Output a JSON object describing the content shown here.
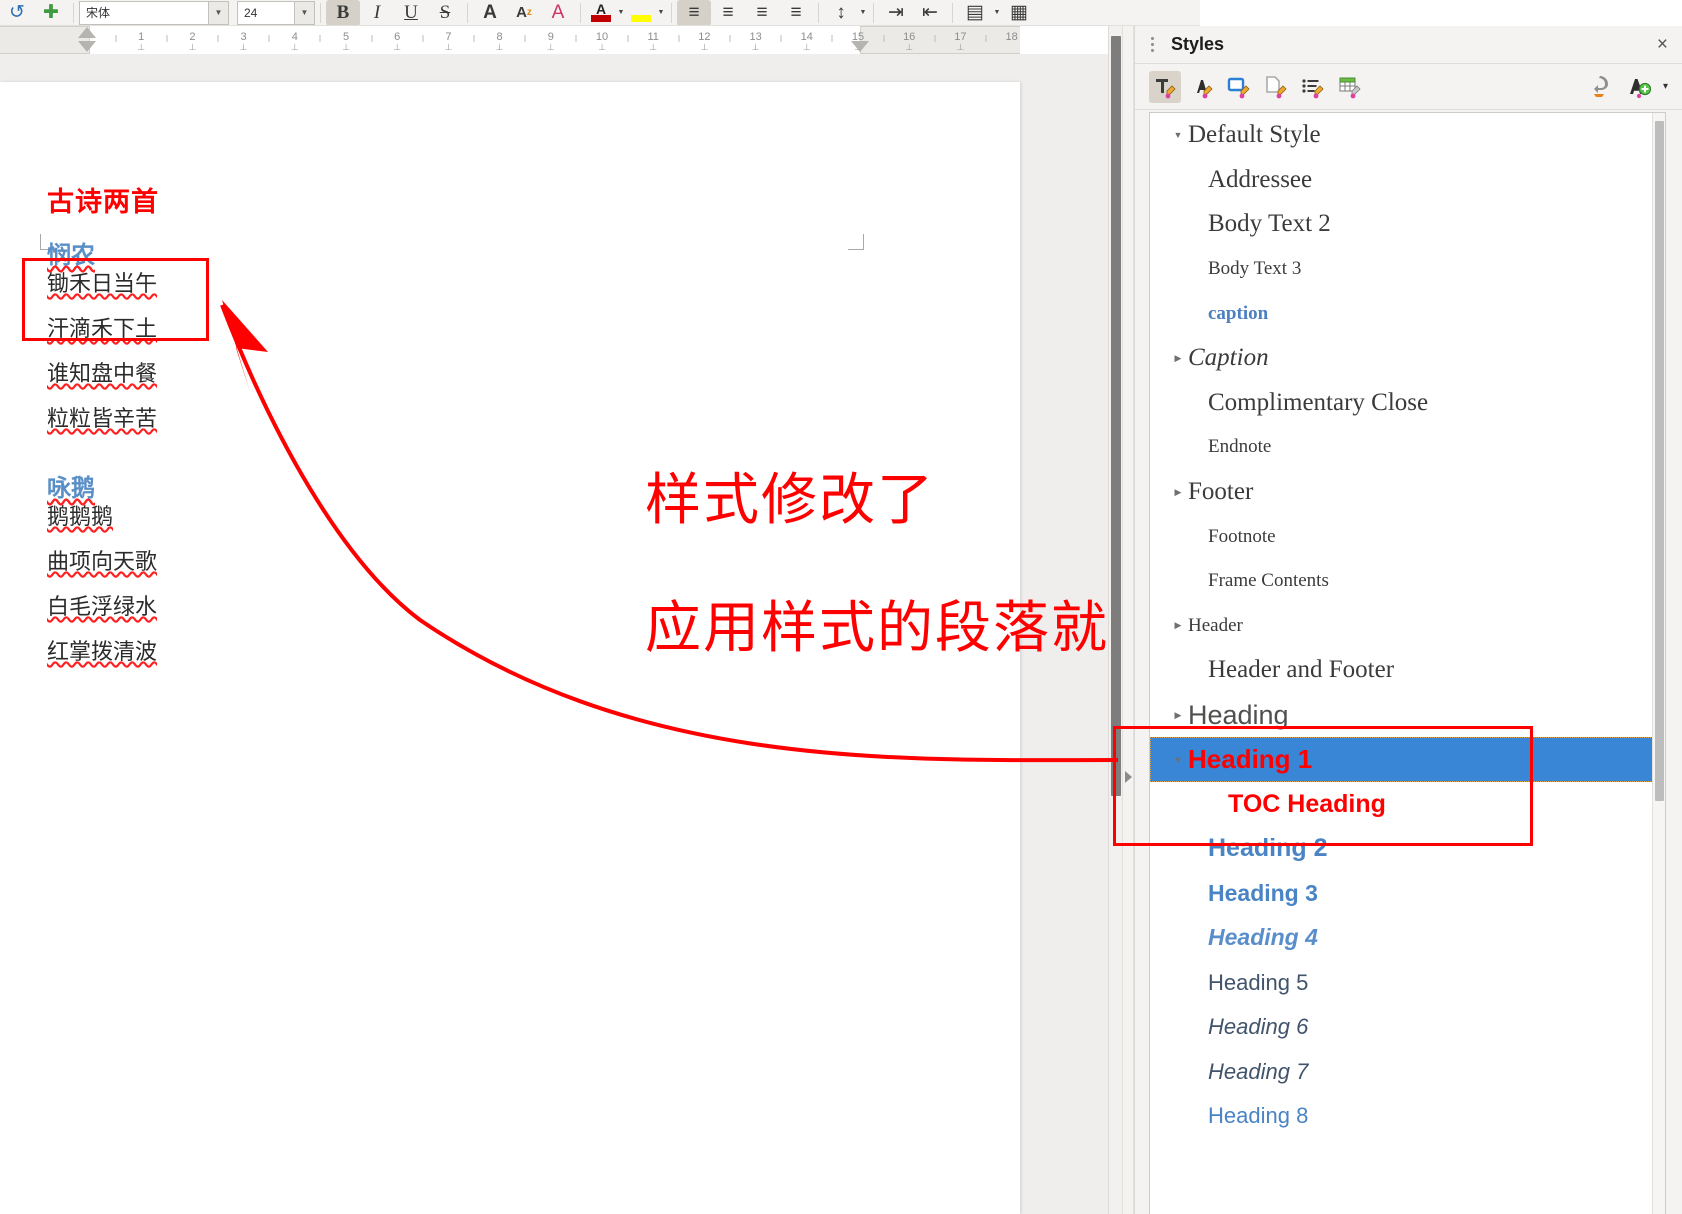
{
  "app": {
    "name": "LibreOffice Writer"
  },
  "toolbar": {
    "font_name_value": "宋体",
    "font_size_value": "24",
    "buttons": [
      {
        "name": "undo-icon",
        "glyph": "↺"
      },
      {
        "name": "insert-special-icon",
        "glyph": "✚"
      },
      {
        "name": "bold-button",
        "glyph": "B",
        "pressed": true
      },
      {
        "name": "italic-button",
        "glyph": "I"
      },
      {
        "name": "underline-button",
        "glyph": "U"
      },
      {
        "name": "strikethrough-button",
        "glyph": "S"
      },
      {
        "name": "increase-font-button",
        "glyph": "A"
      },
      {
        "name": "decrease-font-button",
        "glyph": "A"
      },
      {
        "name": "clear-formatting-button",
        "glyph": "A"
      },
      {
        "name": "font-color-button",
        "glyph": "A",
        "color": "#c00000"
      },
      {
        "name": "highlight-color-button",
        "glyph": "A",
        "color": "#ffff00"
      },
      {
        "name": "align-left-button",
        "glyph": "≡",
        "pressed": true
      },
      {
        "name": "align-center-button",
        "glyph": "≡"
      },
      {
        "name": "align-right-button",
        "glyph": "≡"
      },
      {
        "name": "align-justify-button",
        "glyph": "≡"
      },
      {
        "name": "line-spacing-button",
        "glyph": "↕"
      },
      {
        "name": "increase-indent-button",
        "glyph": "⇥"
      },
      {
        "name": "decrease-indent-button",
        "glyph": "⇤"
      },
      {
        "name": "paragraph-background-button",
        "glyph": "▤"
      },
      {
        "name": "border-button",
        "glyph": "▦"
      }
    ]
  },
  "ruler": {
    "labels": [
      "1",
      "2",
      "3",
      "4",
      "5",
      "6",
      "7",
      "8",
      "9",
      "10",
      "11",
      "12",
      "13",
      "14",
      "15",
      "16",
      "17",
      "18"
    ],
    "left_margin_end": 1,
    "right_margin_start": 15
  },
  "document": {
    "title": "古诗两首",
    "title_color": "#ff0000",
    "poems": [
      {
        "heading": "悯农",
        "heading_color": "#5a8fc6",
        "lines": [
          "锄禾日当午",
          "汗滴禾下土",
          "谁知盘中餐",
          "粒粒皆辛苦"
        ]
      },
      {
        "heading": "咏鹅",
        "heading_color": "#5a8fc6",
        "lines": [
          "鹅鹅鹅",
          "曲项向天歌",
          "白毛浮绿水",
          "红掌拨清波"
        ]
      }
    ]
  },
  "annotations": {
    "color": "#ff0000",
    "line1": "样式修改了",
    "line2": "应用样式的段落就修改了"
  },
  "sidebar": {
    "title": "Styles",
    "close_label": "×",
    "toolbar_icons": [
      {
        "name": "paragraph-styles-icon",
        "active": true
      },
      {
        "name": "character-styles-icon",
        "active": false
      },
      {
        "name": "frame-styles-icon",
        "active": false
      },
      {
        "name": "page-styles-icon",
        "active": false
      },
      {
        "name": "list-styles-icon",
        "active": false
      },
      {
        "name": "table-styles-icon",
        "active": false
      }
    ],
    "right_icons": [
      {
        "name": "fill-format-mode-icon"
      },
      {
        "name": "new-style-from-selection-icon"
      },
      {
        "name": "chevron-down-icon",
        "glyph": "▾"
      }
    ],
    "styles": [
      {
        "label": "Default Style",
        "cls": "s-default",
        "indent": 0,
        "twisty": "▼"
      },
      {
        "label": "Addressee",
        "cls": "s-serif",
        "indent": 1,
        "twisty": ""
      },
      {
        "label": "Body Text 2",
        "cls": "s-serif",
        "indent": 1,
        "twisty": ""
      },
      {
        "label": "Body Text 3",
        "cls": "s-serif-sm",
        "indent": 1,
        "twisty": ""
      },
      {
        "label": "caption",
        "cls": "s-caption",
        "indent": 1,
        "twisty": ""
      },
      {
        "label": "Caption",
        "cls": "s-serif-it",
        "indent": 0,
        "twisty": "▶"
      },
      {
        "label": "Complimentary Close",
        "cls": "s-serif",
        "indent": 1,
        "twisty": ""
      },
      {
        "label": "Endnote",
        "cls": "s-serif-sm",
        "indent": 1,
        "twisty": ""
      },
      {
        "label": "Footer",
        "cls": "s-serif",
        "indent": 0,
        "twisty": "▶"
      },
      {
        "label": "Footnote",
        "cls": "s-serif-sm",
        "indent": 1,
        "twisty": ""
      },
      {
        "label": "Frame Contents",
        "cls": "s-serif-sm",
        "indent": 1,
        "twisty": ""
      },
      {
        "label": "Header",
        "cls": "s-serif-sm",
        "indent": 0,
        "twisty": "▶"
      },
      {
        "label": "Header and Footer",
        "cls": "s-serif",
        "indent": 1,
        "twisty": ""
      },
      {
        "label": "Heading",
        "cls": "s-head",
        "indent": 0,
        "twisty": "▶"
      },
      {
        "label": "Heading 1",
        "cls": "s-h1",
        "indent": 0,
        "twisty": "▼",
        "selected": true
      },
      {
        "label": "TOC Heading",
        "cls": "s-toc",
        "indent": 2,
        "twisty": ""
      },
      {
        "label": "Heading 2",
        "cls": "s-h2",
        "indent": 1,
        "twisty": ""
      },
      {
        "label": "Heading 3",
        "cls": "s-h3",
        "indent": 1,
        "twisty": ""
      },
      {
        "label": "Heading 4",
        "cls": "s-h4",
        "indent": 1,
        "twisty": ""
      },
      {
        "label": "Heading 5",
        "cls": "s-h5",
        "indent": 1,
        "twisty": ""
      },
      {
        "label": "Heading 6",
        "cls": "s-h6",
        "indent": 1,
        "twisty": ""
      },
      {
        "label": "Heading 7",
        "cls": "s-h7",
        "indent": 1,
        "twisty": ""
      },
      {
        "label": "Heading 8",
        "cls": "s-h8",
        "indent": 1,
        "twisty": ""
      }
    ]
  }
}
